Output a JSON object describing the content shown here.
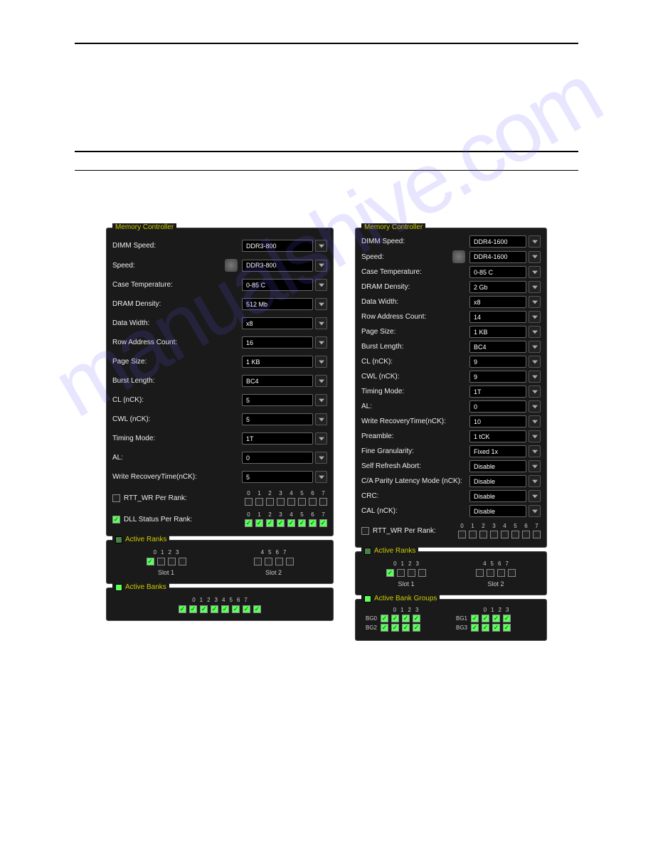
{
  "left": {
    "title": "Memory Controller",
    "fields": [
      {
        "label": "DIMM Speed:",
        "value": "DDR3-800"
      },
      {
        "label": "Speed:",
        "value": "DDR3-800",
        "gear": true
      },
      {
        "label": "Case Temperature:",
        "value": "0-85 C"
      },
      {
        "label": "DRAM Density:",
        "value": "512 Mb"
      },
      {
        "label": "Data Width:",
        "value": "x8"
      },
      {
        "label": "Row Address Count:",
        "value": "16"
      },
      {
        "label": "Page Size:",
        "value": "1 KB"
      },
      {
        "label": "Burst Length:",
        "value": "BC4"
      },
      {
        "label": "CL (nCK):",
        "value": "5"
      },
      {
        "label": "CWL (nCK):",
        "value": "5"
      },
      {
        "label": "Timing Mode:",
        "value": "1T"
      },
      {
        "label": "AL:",
        "value": "0"
      },
      {
        "label": "Write RecoveryTime(nCK):",
        "value": "5"
      }
    ],
    "rtt_label": "RTT_WR Per Rank:",
    "dll_label": "DLL Status Per Rank:",
    "bits": [
      "0",
      "1",
      "2",
      "3",
      "4",
      "5",
      "6",
      "7"
    ],
    "ranks_title": "Active Ranks",
    "slot1": "Slot 1",
    "slot2": "Slot 2",
    "banks_title": "Active Banks"
  },
  "right": {
    "title": "Memory Controller",
    "fields": [
      {
        "label": "DIMM Speed:",
        "value": "DDR4-1600"
      },
      {
        "label": "Speed:",
        "value": "DDR4-1600",
        "gear": true
      },
      {
        "label": "Case Temperature:",
        "value": "0-85 C"
      },
      {
        "label": "DRAM Density:",
        "value": "2 Gb"
      },
      {
        "label": "Data Width:",
        "value": "x8"
      },
      {
        "label": "Row Address Count:",
        "value": "14"
      },
      {
        "label": "Page Size:",
        "value": "1 KB"
      },
      {
        "label": "Burst Length:",
        "value": "BC4"
      },
      {
        "label": "CL (nCK):",
        "value": "9"
      },
      {
        "label": "CWL (nCK):",
        "value": "9"
      },
      {
        "label": "Timing Mode:",
        "value": "1T"
      },
      {
        "label": "AL:",
        "value": "0"
      },
      {
        "label": "Write RecoveryTime(nCK):",
        "value": "10"
      },
      {
        "label": "Preamble:",
        "value": "1 tCK"
      },
      {
        "label": "Fine Granularity:",
        "value": "Fixed 1x"
      },
      {
        "label": "Self Refresh Abort:",
        "value": "Disable"
      },
      {
        "label": "C/A Parity Latency Mode (nCK):",
        "value": "Disable"
      },
      {
        "label": "CRC:",
        "value": "Disable"
      },
      {
        "label": "CAL (nCK):",
        "value": "Disable"
      }
    ],
    "rtt_label": "RTT_WR Per Rank:",
    "bits": [
      "0",
      "1",
      "2",
      "3",
      "4",
      "5",
      "6",
      "7"
    ],
    "ranks_title": "Active Ranks",
    "slot1": "Slot 1",
    "slot2": "Slot 2",
    "bg_title": "Active Bank Groups",
    "bg_nums": [
      "0",
      "1",
      "2",
      "3"
    ],
    "bg_labels": [
      "BG0",
      "BG1",
      "BG2",
      "BG3"
    ]
  },
  "watermark": "manualshive.com"
}
